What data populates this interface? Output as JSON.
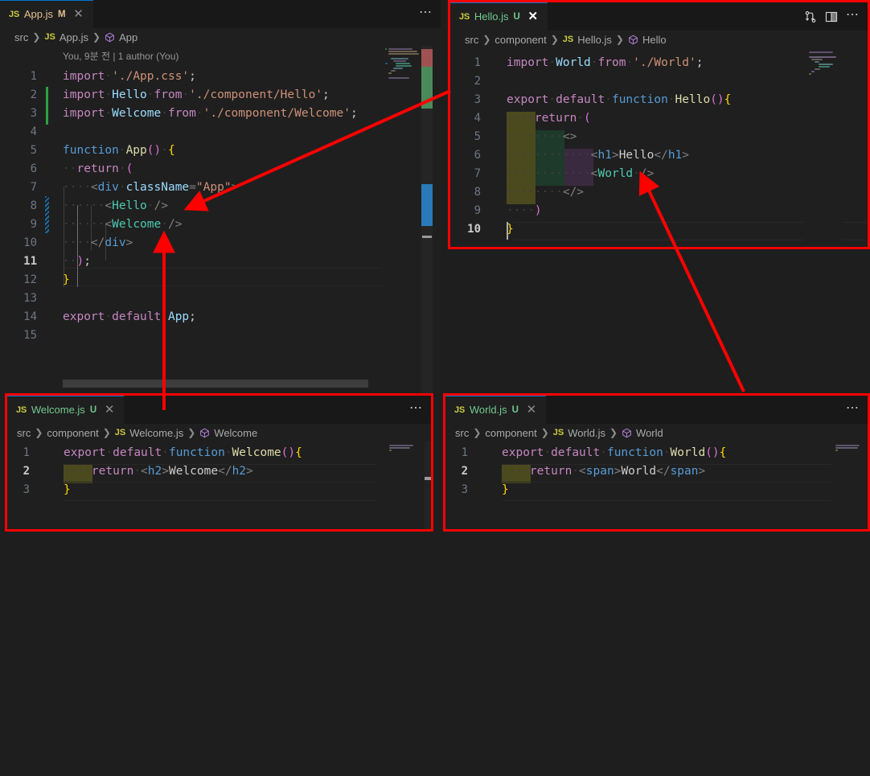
{
  "theme": {
    "editor_bg": "#1f1f1f",
    "tabbar_bg": "#181818",
    "window_bg": "#1e1e1e",
    "accent": "#0078d4",
    "callout_border": "#ff0000",
    "modified_tab": "#e2c08d",
    "untracked_tab": "#73c991",
    "added_gutter": "#2ea043",
    "modified_gutter": "#1b6ca8"
  },
  "panels": {
    "app": {
      "tab": {
        "icon": "js-file-icon",
        "label": "App.js",
        "status": "M",
        "status_title": "Modified",
        "close": "✕"
      },
      "overflow": "⋯",
      "breadcrumb": [
        "src",
        "App.js",
        "App"
      ],
      "breadcrumb_icons": [
        "",
        "js-file-icon",
        "symbol-class-icon"
      ],
      "blame": "You, 9분 전 | 1 author (You)",
      "lines": [
        {
          "n": 1,
          "text": "import './App.css';"
        },
        {
          "n": 2,
          "text": "import Hello from './component/Hello';"
        },
        {
          "n": 3,
          "text": "import Welcome from './component/Welcome';"
        },
        {
          "n": 4,
          "text": ""
        },
        {
          "n": 5,
          "text": "function App() {"
        },
        {
          "n": 6,
          "text": "  return ("
        },
        {
          "n": 7,
          "text": "    <div className=\"App\">"
        },
        {
          "n": 8,
          "text": "      <Hello />"
        },
        {
          "n": 9,
          "text": "      <Welcome />"
        },
        {
          "n": 10,
          "text": "    </div>"
        },
        {
          "n": 11,
          "text": "  );"
        },
        {
          "n": 12,
          "text": "}"
        },
        {
          "n": 13,
          "text": ""
        },
        {
          "n": 14,
          "text": "export default App;"
        },
        {
          "n": 15,
          "text": ""
        }
      ],
      "current_line": 11
    },
    "hello": {
      "tab": {
        "icon": "js-file-icon",
        "label": "Hello.js",
        "status": "U",
        "status_title": "Untracked",
        "close": "✕"
      },
      "actions": [
        "source-control-compare-icon",
        "split-editor-icon",
        "overflow-icon"
      ],
      "overflow": "⋯",
      "breadcrumb": [
        "src",
        "component",
        "Hello.js",
        "Hello"
      ],
      "lines": [
        {
          "n": 1,
          "text": "import World from './World';"
        },
        {
          "n": 2,
          "text": ""
        },
        {
          "n": 3,
          "text": "export default function Hello(){"
        },
        {
          "n": 4,
          "text": "    return ("
        },
        {
          "n": 5,
          "text": "        <>"
        },
        {
          "n": 6,
          "text": "            <h1>Hello</h1>"
        },
        {
          "n": 7,
          "text": "            <World />"
        },
        {
          "n": 8,
          "text": "        </>"
        },
        {
          "n": 9,
          "text": "    )"
        },
        {
          "n": 10,
          "text": "}"
        }
      ],
      "current_line": 10
    },
    "welcome": {
      "tab": {
        "icon": "js-file-icon",
        "label": "Welcome.js",
        "status": "U",
        "status_title": "Untracked",
        "close": "✕"
      },
      "overflow": "⋯",
      "breadcrumb": [
        "src",
        "component",
        "Welcome.js",
        "Welcome"
      ],
      "lines": [
        {
          "n": 1,
          "text": "export default function Welcome(){"
        },
        {
          "n": 2,
          "text": "    return <h2>Welcome</h2>"
        },
        {
          "n": 3,
          "text": "}"
        }
      ],
      "current_line": 2
    },
    "world": {
      "tab": {
        "icon": "js-file-icon",
        "label": "World.js",
        "status": "U",
        "status_title": "Untracked",
        "close": "✕"
      },
      "overflow": "⋯",
      "breadcrumb": [
        "src",
        "component",
        "World.js",
        "World"
      ],
      "lines": [
        {
          "n": 1,
          "text": "export default function World(){"
        },
        {
          "n": 2,
          "text": "    return <span>World</span>"
        },
        {
          "n": 3,
          "text": "}"
        }
      ],
      "current_line": 2
    }
  },
  "annotations": {
    "arrows": [
      {
        "name": "arrow-hello-import-to-hellojs",
        "from": "Hello.js panel",
        "to": "<Hello /> in App.js"
      },
      {
        "name": "arrow-welcome-to-welcomejs",
        "from": "Welcome.js panel",
        "to": "<Welcome /> in App.js"
      },
      {
        "name": "arrow-world-to-worldjs",
        "from": "World.js panel",
        "to": "<World /> in Hello.js"
      }
    ]
  }
}
